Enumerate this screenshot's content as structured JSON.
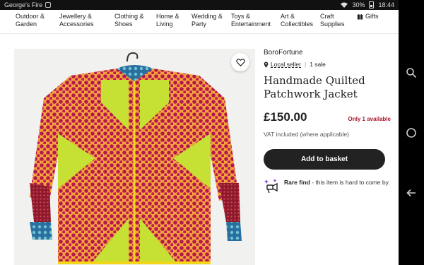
{
  "status_bar": {
    "carrier": "George's Fire",
    "battery": "30%",
    "time": "18:44"
  },
  "categories": [
    {
      "label": "Outdoor &\nGarden"
    },
    {
      "label": "Jewellery &\nAccessories"
    },
    {
      "label": "Clothing &\nShoes"
    },
    {
      "label": "Home &\nLiving"
    },
    {
      "label": "Wedding &\nParty"
    },
    {
      "label": "Toys &\nEntertainment"
    },
    {
      "label": "Art &\nCollectibles"
    },
    {
      "label": "Craft\nSupplies"
    },
    {
      "label": "Gifts"
    }
  ],
  "product": {
    "shop_name": "BoroFortune",
    "local_seller": "Local seller",
    "sales": "1 sale",
    "title": "Handmade Quilted Patchwork Jacket",
    "price": "£150.00",
    "availability": "Only 1 available",
    "vat_note": "VAT included (where applicable)",
    "add_to_basket": "Add to basket",
    "rare_find_label": "Rare find",
    "rare_find_text": " - this item is hard to come by."
  },
  "colors": {
    "accent_red": "#a61a2e",
    "button_dark": "#222222",
    "rare_purple": "#8a4fd0"
  },
  "icons": {
    "favorite": "heart-icon",
    "gift": "gift-icon",
    "location": "pin-icon",
    "rare": "rare-find-icon"
  }
}
